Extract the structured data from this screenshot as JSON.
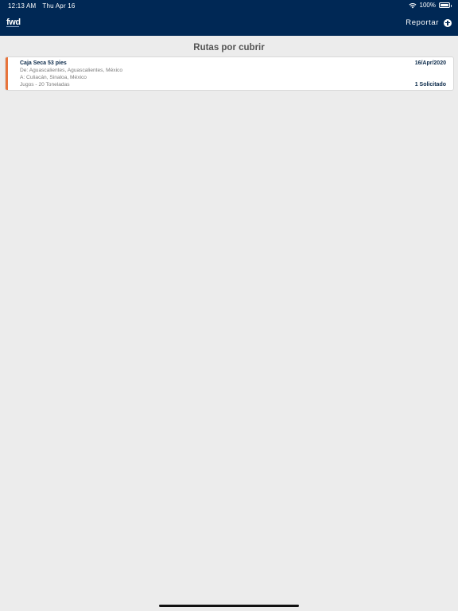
{
  "status_bar": {
    "time": "12:13 AM",
    "day": "Thu Apr 16",
    "battery": "100%"
  },
  "header": {
    "logo": "fwd",
    "report_label": "Reportar"
  },
  "page": {
    "title": "Rutas por cubrir"
  },
  "routes": [
    {
      "title": "Caja Seca 53 pies",
      "from": "De: Aguascalientes, Aguascalientes, México",
      "to": "A: Culiacán, Sinaloa, México",
      "cargo": "Jugos - 20 Toneladas",
      "date": "16/Apr/2020",
      "requested": "1 Solicitado"
    }
  ],
  "colors": {
    "header_bg": "#002855",
    "accent": "#e8743b",
    "background": "#ececec"
  }
}
